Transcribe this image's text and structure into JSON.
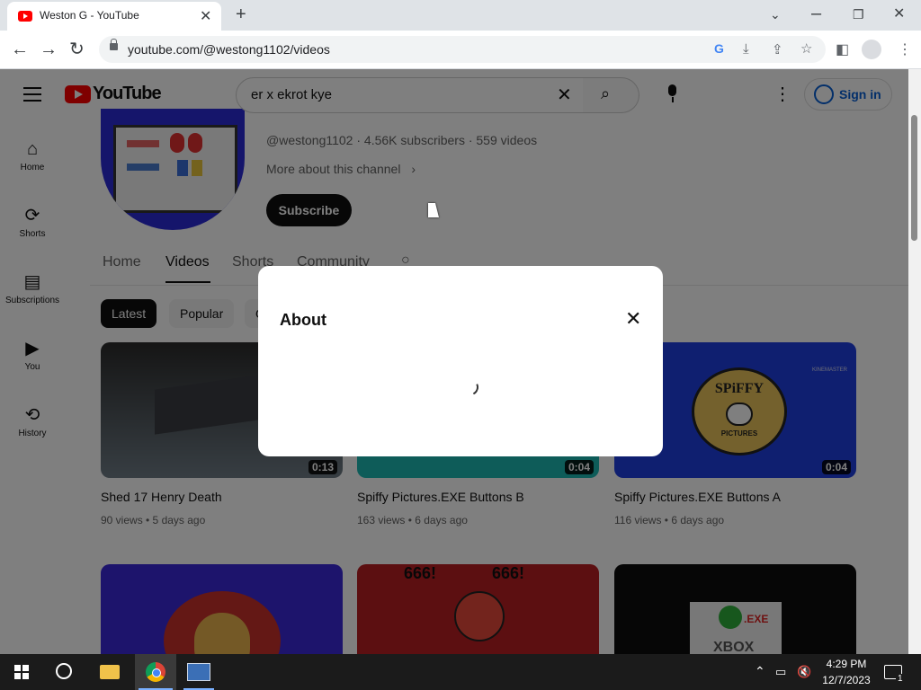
{
  "browser": {
    "tab_title": "Weston G - YouTube",
    "new_tab_symbol": "+",
    "url": "youtube.com/@westong1102/videos"
  },
  "youtube": {
    "logo_text": "YouTube",
    "search_value": "er x ekrot kye",
    "signin_label": "Sign in",
    "sidebar": [
      {
        "label": "Home",
        "icon": "home-icon"
      },
      {
        "label": "Shorts",
        "icon": "shorts-icon"
      },
      {
        "label": "Subscriptions",
        "icon": "subscriptions-icon"
      },
      {
        "label": "You",
        "icon": "you-icon"
      },
      {
        "label": "History",
        "icon": "history-icon"
      }
    ],
    "channel": {
      "meta": "@westong1102 · 4.56K subscribers · 559 videos",
      "more_about": "More about this channel",
      "subscribe_label": "Subscribe"
    },
    "tabs": [
      "Home",
      "Videos",
      "Shorts",
      "Community"
    ],
    "active_tab": "Videos",
    "chips": [
      "Latest",
      "Popular",
      "O"
    ],
    "videos": [
      {
        "title": "Shed 17 Henry Death",
        "meta": "90 views • 5 days ago",
        "duration": "0:13"
      },
      {
        "title": "Spiffy Pictures.EXE Buttons B",
        "meta": "163 views • 6 days ago",
        "duration": "0:04"
      },
      {
        "title": "Spiffy Pictures.EXE Buttons A",
        "meta": "116 views • 6 days ago",
        "duration": "0:04"
      }
    ],
    "thumb_text": {
      "spiffy": "SPiFFY",
      "pictures": "PICTURES",
      "kinemaster": "KINEMASTER",
      "xbox": "XBOX",
      "exe": ".EXE",
      "nums": "666!",
      "nums2": "666!"
    }
  },
  "dialog": {
    "title": "About"
  },
  "taskbar": {
    "time": "4:29 PM",
    "date": "12/7/2023",
    "notif_count": "1"
  },
  "colors": {
    "yt_red": "#ff0000",
    "link_blue": "#065fd4",
    "taskbar": "#1b1b1b"
  }
}
